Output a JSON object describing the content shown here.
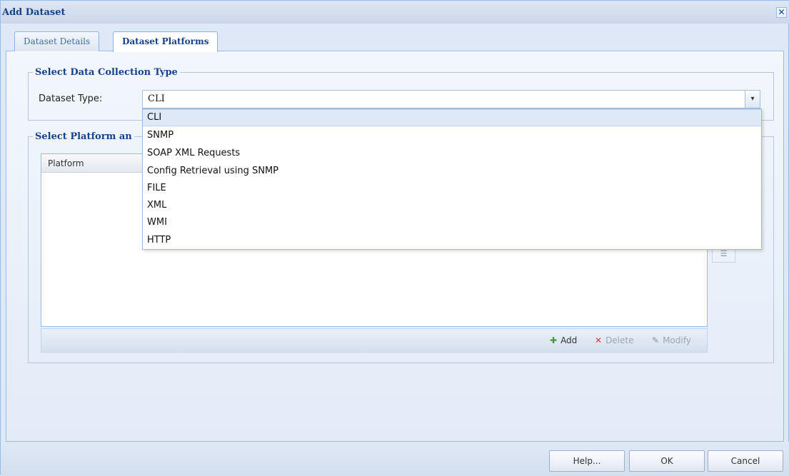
{
  "window": {
    "title": "Add Dataset",
    "close_glyph": "✕"
  },
  "tabs": [
    {
      "label": "Dataset Details",
      "active": false
    },
    {
      "label": "Dataset Platforms",
      "active": true
    }
  ],
  "collection_section": {
    "legend": "Select Data Collection Type",
    "dataset_type_label": "Dataset Type:",
    "dataset_type_value": "CLI",
    "trigger_glyph": "▾"
  },
  "dropdown": {
    "options": [
      "CLI",
      "SNMP",
      "SOAP XML Requests",
      "Config Retrieval using SNMP",
      "FILE",
      "XML",
      "WMI",
      "HTTP"
    ],
    "selected": "CLI"
  },
  "platform_section": {
    "legend": "Select Platform an",
    "grid_columns": [
      "Platform"
    ],
    "toolbar": {
      "add_label": "Add",
      "delete_label": "Delete",
      "modify_label": "Modify",
      "add_icon": "✚",
      "delete_icon": "✕",
      "modify_icon": "✎"
    },
    "side_icon_glyph": "☰"
  },
  "footer": {
    "help_label": "Help...",
    "ok_label": "OK",
    "cancel_label": "Cancel"
  },
  "colors": {
    "title_text": "#15428b",
    "border": "#99bbe8",
    "add_icon": "#3c9a2c",
    "delete_icon": "#d43b3b"
  }
}
